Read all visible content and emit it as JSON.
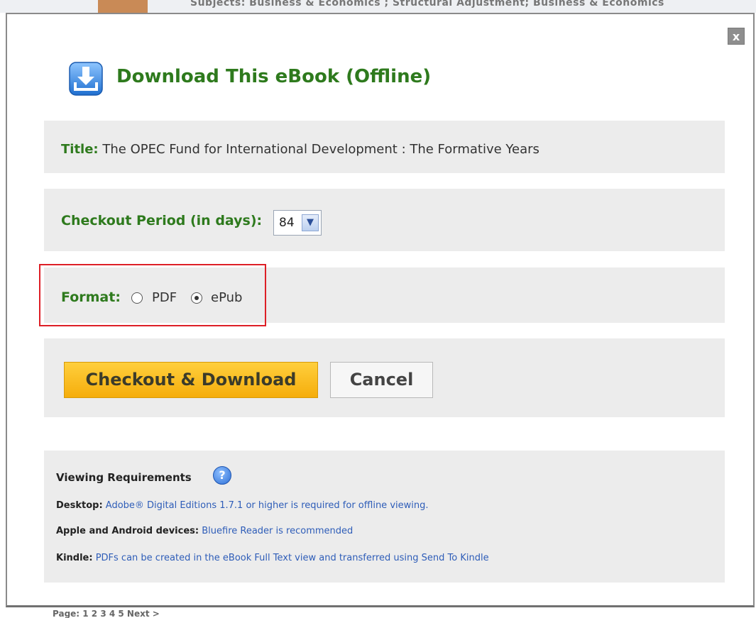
{
  "background": {
    "top_text": "Subjects: Business & Economics ; Structural Adjustment; Business & Economics",
    "bottom_text": "Page: 1 2 3 4 5 Next >"
  },
  "modal": {
    "close_label": "x",
    "title": "Download This eBook (Offline)",
    "title_field": {
      "label": "Title:",
      "value": "The OPEC Fund for International Development : The Formative Years"
    },
    "checkout_period": {
      "label": "Checkout Period (in days):",
      "selected": "84"
    },
    "format": {
      "label": "Format:",
      "options": [
        "PDF",
        "ePub"
      ],
      "selected": "ePub"
    },
    "buttons": {
      "checkout": "Checkout & Download",
      "cancel": "Cancel"
    },
    "requirements": {
      "heading": "Viewing Requirements",
      "help_glyph": "?",
      "lines": [
        {
          "label": "Desktop:",
          "text": "Adobe® Digital Editions 1.7.1 or higher is required for offline viewing."
        },
        {
          "label": "Apple and Android devices:",
          "text": "Bluefire Reader is recommended"
        },
        {
          "label": "Kindle:",
          "text": "PDFs can be created in the eBook Full Text view and transferred using Send To Kindle"
        }
      ]
    }
  },
  "colors": {
    "title_green": "#2e7a1d",
    "highlight_red": "#dd1f26",
    "checkout_orange": "#f5ad0b",
    "link_blue": "#2e5db8"
  },
  "icons": [
    "download-icon",
    "close-icon",
    "help-icon",
    "chevron-down-icon"
  ]
}
